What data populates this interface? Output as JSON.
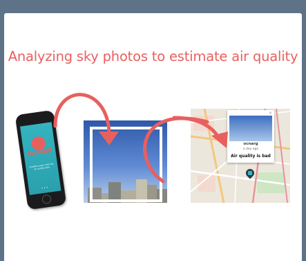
{
  "headline": "Analyzing sky photos to estimate air quality",
  "phone": {
    "app_name": "hackAIR",
    "tagline": "breathe easier with the air quality data",
    "dots": "• • •"
  },
  "photo": {
    "caption": ""
  },
  "map": {
    "popup": {
      "username": "ocnarg",
      "time": "a day ago",
      "status": "Air quality is bad",
      "close": "×"
    }
  },
  "colors": {
    "accent": "#e8605e",
    "background": "#5f7388",
    "card": "#ffffff"
  },
  "icons": [
    "camera-icon",
    "map-pin-icon",
    "close-icon",
    "balloon-icon"
  ]
}
